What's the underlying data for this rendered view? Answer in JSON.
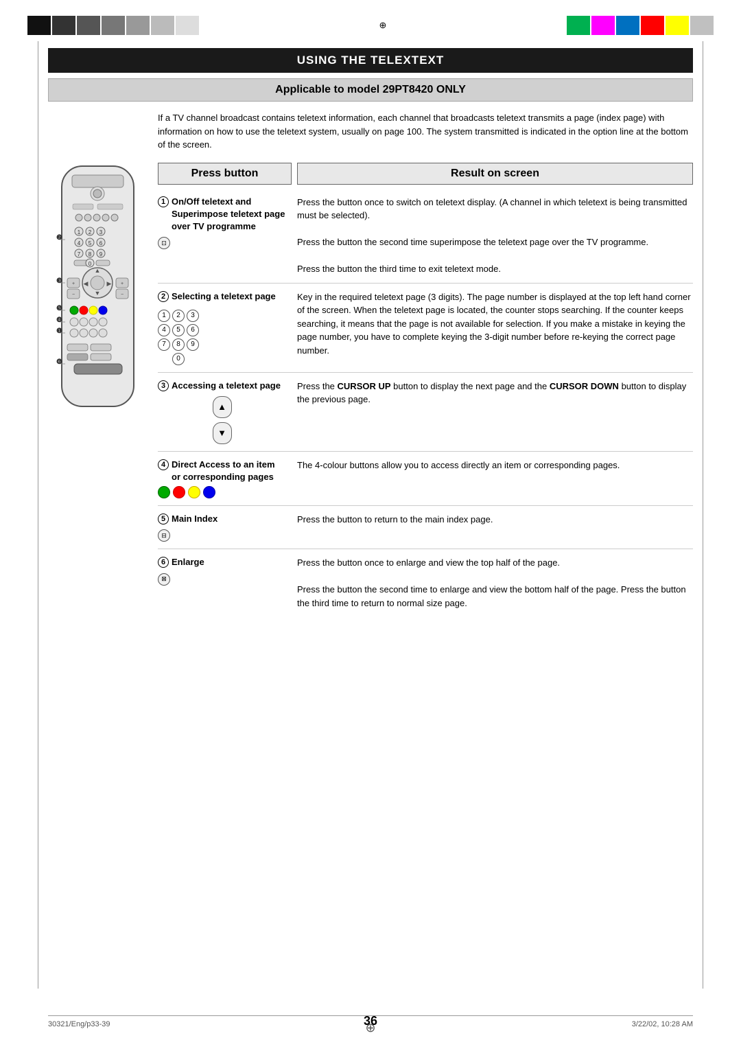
{
  "page": {
    "title": "USING THE TELEXTEXT",
    "subtitle": "Applicable to model 29PT8420 ONLY",
    "intro": "If a TV channel broadcast contains teletext information, each channel that broadcasts teletext transmits a page (index page) with information on how to use the teletext system, usually on page 100. The system transmitted is indicated in the option line at the bottom of the screen.",
    "col_press": "Press button",
    "col_result": "Result on screen",
    "rows": [
      {
        "num": "1",
        "press_title": "On/Off teletext and Superimpose teletext page over TV programme",
        "result": "Press the button once to switch on teletext display.  (A channel in which teletext is being transmitted must be selected).\nPress the button the second time superimpose the teletext page over the TV programme.\nPress the button the third time to exit teletext mode."
      },
      {
        "num": "2",
        "press_title": "Selecting a teletext page",
        "result": "Key in the required teletext page (3 digits). The page number is displayed at the top left hand corner of the screen.  When the teletext page is located, the counter stops searching. If the counter keeps searching, it means that the page is not available for selection. If you make a mistake in keying the page number, you have to complete keying the 3-digit number before re-keying the correct page number."
      },
      {
        "num": "3",
        "press_title": "Accessing a teletext page",
        "result": "Press the CURSOR UP button to display the next page and the CURSOR DOWN button to display the previous page."
      },
      {
        "num": "4",
        "press_title": "Direct Access to an item or corresponding pages",
        "result": "The 4-colour buttons allow you to access directly an item or corresponding pages."
      },
      {
        "num": "5",
        "press_title": "Main Index",
        "result": "Press the button to return to the main index page."
      },
      {
        "num": "6",
        "press_title": "Enlarge",
        "result": "Press the button once to enlarge and view the top half of the page.\nPress the button the second time to enlarge and view the bottom half of the page. Press the button the third time to return to normal size page."
      }
    ],
    "footer": {
      "left": "30321/Eng/p33-39",
      "center": "36",
      "right": "3/22/02, 10:28 AM"
    },
    "sidebar_labels": [
      "2",
      "3",
      "5",
      "4",
      "1",
      "6"
    ]
  },
  "colors": {
    "grayscale": [
      "#111",
      "#333",
      "#555",
      "#777",
      "#999",
      "#bbb",
      "#ddd"
    ],
    "spectrum": [
      "#00b050",
      "#ff00ff",
      "#0070c0",
      "#ff0000",
      "#ffff00",
      "#c0c0c0"
    ]
  }
}
